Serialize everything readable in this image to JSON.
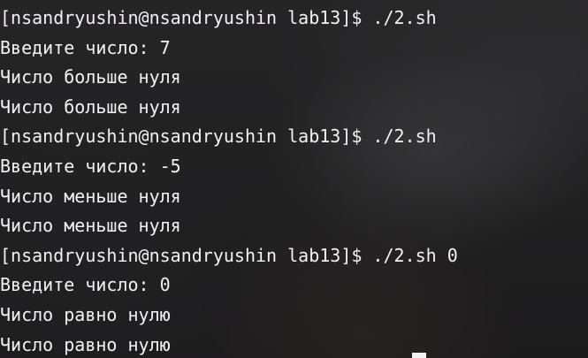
{
  "terminal": {
    "lines": [
      "[nsandryushin@nsandryushin lab13]$ ./2.sh",
      "Введите число: 7",
      "Число больше нуля",
      "Число больше нуля",
      "[nsandryushin@nsandryushin lab13]$ ./2.sh",
      "Введите число: -5",
      "Число меньше нуля",
      "Число меньше нуля",
      "[nsandryushin@nsandryushin lab13]$ ./2.sh 0",
      "Введите число: 0",
      "Число равно нулю",
      "Число равно нулю"
    ]
  }
}
